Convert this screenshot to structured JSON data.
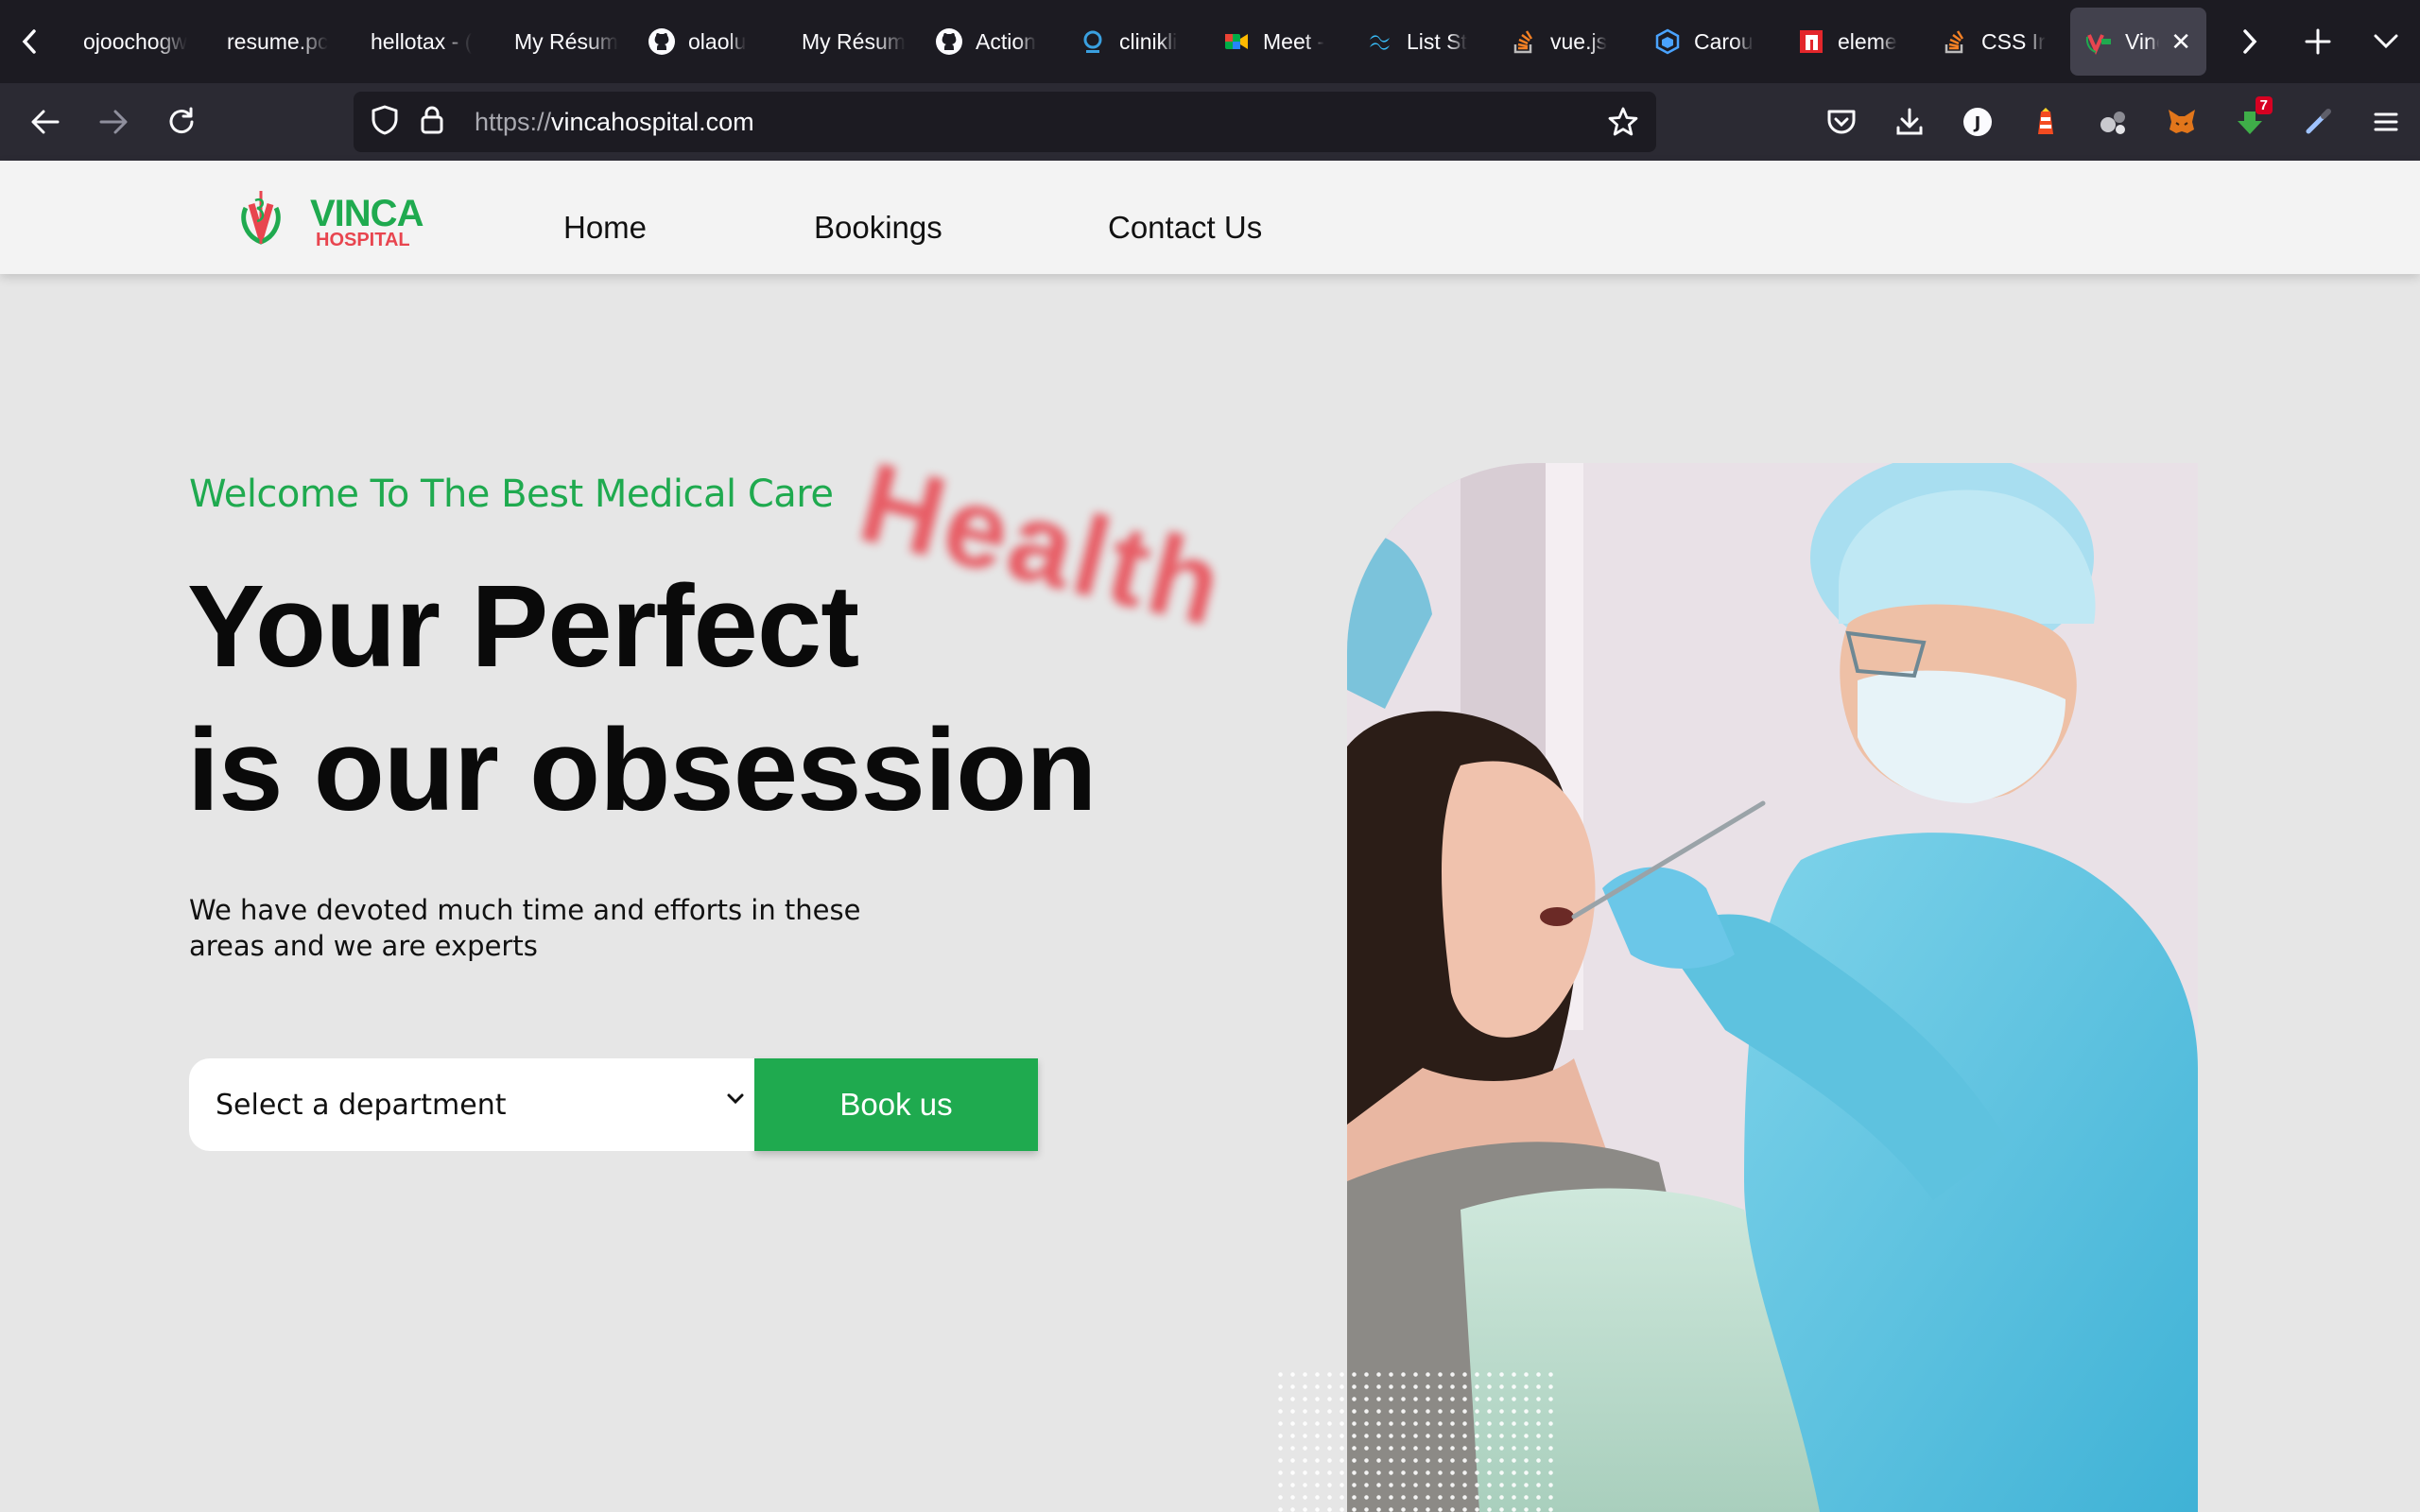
{
  "browser": {
    "tabs": [
      {
        "label": "ojoochogw",
        "icon": "generic-page-icon"
      },
      {
        "label": "resume.pc",
        "icon": "generic-page-icon"
      },
      {
        "label": "hellotax - (",
        "icon": "generic-page-icon"
      },
      {
        "label": "My Résum",
        "icon": "generic-page-icon"
      },
      {
        "label": "olaolu",
        "icon": "github-icon"
      },
      {
        "label": "My Résum",
        "icon": "generic-page-icon"
      },
      {
        "label": "Action",
        "icon": "github-icon"
      },
      {
        "label": "clinikli",
        "icon": "cliniki-icon"
      },
      {
        "label": "Meet -",
        "icon": "google-meet-icon"
      },
      {
        "label": "List St",
        "icon": "tailwind-icon"
      },
      {
        "label": "vue.js",
        "icon": "stackoverflow-icon"
      },
      {
        "label": "Carou",
        "icon": "cube-icon"
      },
      {
        "label": "eleme",
        "icon": "n-logo-icon"
      },
      {
        "label": "CSS Ir",
        "icon": "stackoverflow-icon"
      },
      {
        "label": "Vinc",
        "icon": "vinca-favicon-icon",
        "active": true
      }
    ],
    "url_scheme": "https://",
    "url_host": "vincahospital.com",
    "extension_badge": "7"
  },
  "site": {
    "logo_name": "VINCA",
    "logo_sub": "HOSPITAL",
    "nav": {
      "home": "Home",
      "bookings": "Bookings",
      "contact": "Contact Us"
    }
  },
  "hero": {
    "welcome": "Welcome To The Best Medical Care",
    "floating_word": "Health",
    "headline_line1": "Your Perfect",
    "headline_line2": "is our obsession",
    "description": "We have devoted much time and efforts in these areas and we are experts",
    "select_placeholder": "Select a department",
    "book_button": "Book us"
  },
  "colors": {
    "brand_green": "#1faa4f",
    "brand_red": "#e8454f",
    "page_bg": "#e6e6e6",
    "header_bg": "#f3f3f3",
    "chrome_dark": "#1c1b22",
    "chrome_toolbar": "#2b2a33"
  }
}
